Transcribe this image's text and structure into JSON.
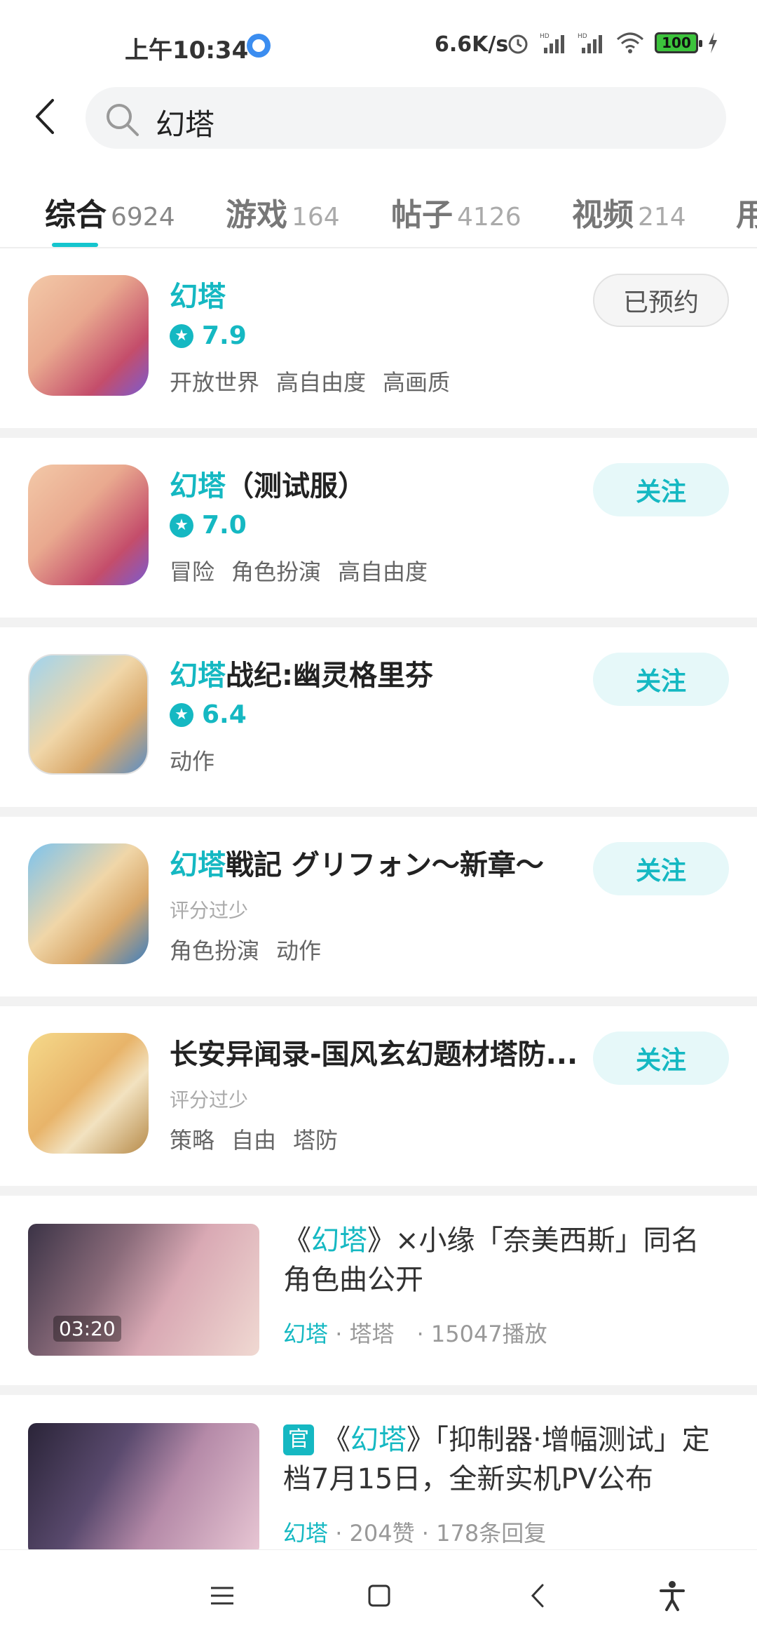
{
  "status_bar": {
    "time": "上午10:34",
    "net_speed": "6.6K/s",
    "battery": "100"
  },
  "search": {
    "query": "幻塔"
  },
  "tabs": [
    {
      "label": "综合",
      "count": "6924"
    },
    {
      "label": "游戏",
      "count": "164"
    },
    {
      "label": "帖子",
      "count": "4126"
    },
    {
      "label": "视频",
      "count": "214"
    },
    {
      "label": "用",
      "count": ""
    }
  ],
  "games": [
    {
      "title_hl": "幻塔",
      "title_rest": "",
      "rating": "7.9",
      "rating_note": "",
      "tags": [
        "开放世界",
        "高自由度",
        "高画质"
      ],
      "button": "已预约",
      "icon_colors": [
        "#f3c9a8",
        "#c44d6b",
        "#7b5bd0"
      ]
    },
    {
      "title_hl": "幻塔",
      "title_rest": "（测试服）",
      "rating": "7.0",
      "rating_note": "",
      "tags": [
        "冒险",
        "角色扮演",
        "高自由度"
      ],
      "button": "关注",
      "icon_colors": [
        "#f3c9a8",
        "#c44d6b",
        "#7b5bd0"
      ]
    },
    {
      "title_hl": "幻塔",
      "title_rest": "战纪:幽灵格里芬",
      "rating": "6.4",
      "rating_note": "",
      "tags": [
        "动作"
      ],
      "button": "关注",
      "icon_colors": [
        "#9fd4ef",
        "#f0d6a8",
        "#5a8fc8"
      ]
    },
    {
      "title_hl": "幻塔",
      "title_rest": "戦記 グリフォン～新章～",
      "rating": "",
      "rating_note": "评分过少",
      "tags": [
        "角色扮演",
        "动作"
      ],
      "button": "关注",
      "icon_colors": [
        "#7cc3ee",
        "#f0d6a8",
        "#3d7fc0"
      ]
    },
    {
      "title_hl": "",
      "title_rest": "长安异闻录-国风玄幻题材塔防...",
      "rating": "",
      "rating_note": "评分过少",
      "tags": [
        "策略",
        "自由",
        "塔防"
      ],
      "button": "关注",
      "icon_colors": [
        "#f5d98a",
        "#e8b46a",
        "#b78b4a"
      ]
    }
  ],
  "videos": [
    {
      "title_pre": "《",
      "title_hl": "幻塔",
      "title_post": "》×小缘「奈美西斯」同名角色曲公开",
      "duration": "03:20",
      "meta_hl": "幻塔",
      "meta_rest": " · 塔塔　· 15047播放",
      "official": ""
    },
    {
      "title_pre": "《",
      "title_hl": "幻塔",
      "title_post": "》「抑制器·增幅测试」定档7月15日，全新实机PV公布",
      "duration": "",
      "meta_hl": "幻塔",
      "meta_rest": " · 204赞 · 178条回复",
      "official": "官"
    }
  ]
}
